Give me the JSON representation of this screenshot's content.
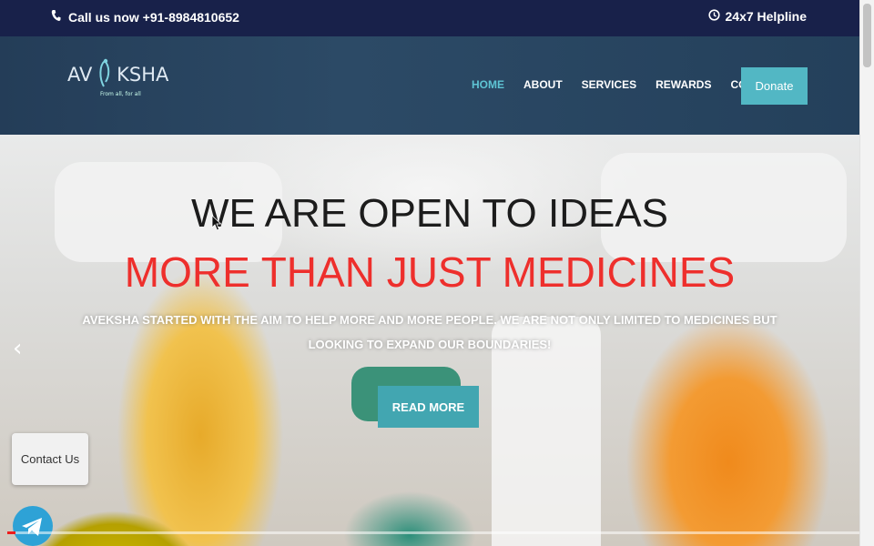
{
  "topbar": {
    "call": "Call us now +91-8984810652",
    "helpline": "24x7 Helpline"
  },
  "logo": {
    "text": "AVEKSHA",
    "tagline": "From all, for all"
  },
  "nav": {
    "items": [
      {
        "label": "HOME",
        "active": true
      },
      {
        "label": "ABOUT"
      },
      {
        "label": "SERVICES"
      },
      {
        "label": "REWARDS"
      },
      {
        "label": "CONTACT"
      }
    ],
    "donate": "Donate"
  },
  "hero": {
    "headline": "WE ARE OPEN TO IDEAS",
    "subheadline": "MORE THAN JUST MEDICINES",
    "body": "AVEKSHA STARTED WITH THE AIM TO HELP MORE AND MORE PEOPLE. WE ARE NOT ONLY LIMITED TO MEDICINES BUT LOOKING TO EXPAND OUR BOUNDARIES!",
    "cta": "READ MORE"
  },
  "widgets": {
    "contact": "Contact Us"
  },
  "colors": {
    "accent": "#52b7c4",
    "topbar": "#18214a",
    "headline_red": "#ee2f2c"
  },
  "video_progress": 0.01
}
